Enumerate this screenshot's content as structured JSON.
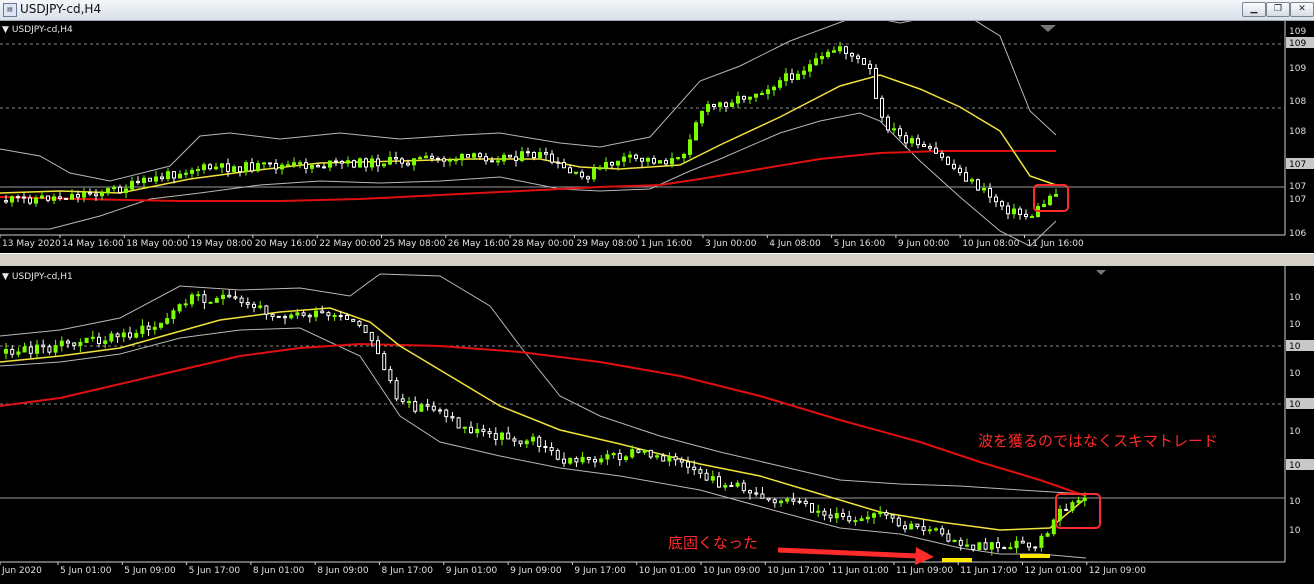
{
  "window": {
    "title": "USDJPY-cd,H4",
    "minimize_label": "▁",
    "restore_label": "❐",
    "close_label": "✕"
  },
  "colors": {
    "bg": "#000000",
    "up": "#7cfc00",
    "down": "#ffffff",
    "ma_yellow": "#f2e33a",
    "ma_red": "#e01010",
    "bands": "#b8b8b8",
    "annotation": "#ff2a2a",
    "marker": "#ffe800"
  },
  "chart_h4": {
    "label": "USDJPY-cd,H4",
    "price_labels": [
      "109",
      "109",
      "109",
      "108",
      "108",
      "107",
      "107",
      "107",
      "106"
    ],
    "highlighted_price_labels": [
      1,
      5
    ],
    "time_labels": [
      "13 May 2020",
      "14 May 16:00",
      "18 May 00:00",
      "19 May 08:00",
      "20 May 16:00",
      "22 May 00:00",
      "25 May 08:00",
      "26 May 16:00",
      "28 May 00:00",
      "29 May 08:00",
      "1 Jun 16:00",
      "3 Jun 00:00",
      "4 Jun 08:00",
      "5 Jun 16:00",
      "9 Jun 00:00",
      "10 Jun 08:00",
      "11 Jun 16:00"
    ]
  },
  "chart_h1": {
    "label": "USDJPY-cd,H1",
    "price_labels": [
      "10",
      "10",
      "10",
      "10",
      "10",
      "10",
      "10",
      "10",
      "10"
    ],
    "highlighted_price_labels": [
      2,
      4,
      6
    ],
    "time_labels": [
      "Jun 2020",
      "5 Jun 01:00",
      "5 Jun 09:00",
      "5 Jun 17:00",
      "8 Jun 01:00",
      "8 Jun 09:00",
      "8 Jun 17:00",
      "9 Jun 01:00",
      "9 Jun 09:00",
      "9 Jun 17:00",
      "10 Jun 01:00",
      "10 Jun 09:00",
      "10 Jun 17:00",
      "11 Jun 01:00",
      "11 Jun 09:00",
      "11 Jun 17:00",
      "12 Jun 01:00",
      "12 Jun 09:00"
    ]
  },
  "annotations": {
    "skim_trade": "波を獲るのではなくスキマトレード",
    "bottomed": "底固くなった"
  }
}
